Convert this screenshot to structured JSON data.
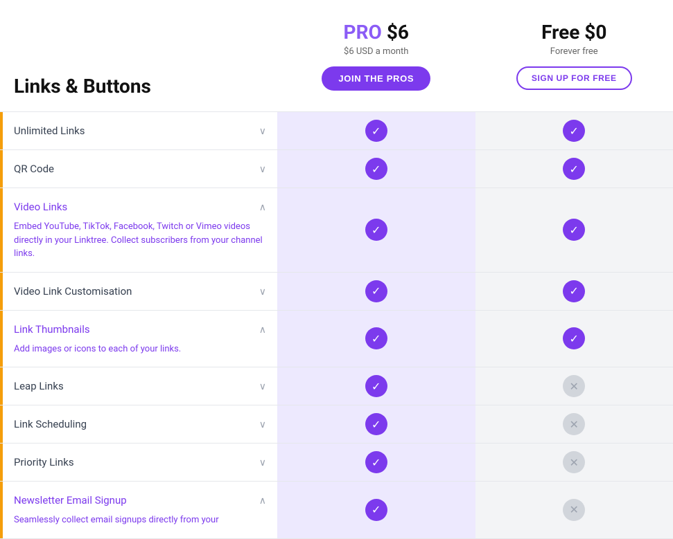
{
  "page": {
    "section_title": "Links & Buttons"
  },
  "plans": {
    "pro": {
      "name": "PRO",
      "price": "$6",
      "subtitle": "$6 USD a month",
      "cta_label": "JOIN THE PROS",
      "color": "#7c3aed"
    },
    "free": {
      "name": "Free",
      "price": "$0",
      "subtitle": "Forever free",
      "cta_label": "SIGN UP FOR FREE"
    }
  },
  "features": [
    {
      "id": "unlimited-links",
      "name": "Unlimited Links",
      "expanded": false,
      "highlight": false,
      "description": null,
      "pro": true,
      "free": true
    },
    {
      "id": "qr-code",
      "name": "QR Code",
      "expanded": false,
      "highlight": false,
      "description": null,
      "pro": true,
      "free": true
    },
    {
      "id": "video-links",
      "name": "Video Links",
      "expanded": true,
      "highlight": true,
      "description": "Embed YouTube, TikTok, Facebook, Twitch or Vimeo videos directly in your Linktree. Collect subscribers from your channel links.",
      "pro": true,
      "free": true
    },
    {
      "id": "video-link-customisation",
      "name": "Video Link Customisation",
      "expanded": false,
      "highlight": false,
      "description": null,
      "pro": true,
      "free": true
    },
    {
      "id": "link-thumbnails",
      "name": "Link Thumbnails",
      "expanded": true,
      "highlight": true,
      "description": "Add images or icons to each of your links.",
      "pro": true,
      "free": true
    },
    {
      "id": "leap-links",
      "name": "Leap Links",
      "expanded": false,
      "highlight": false,
      "description": null,
      "pro": true,
      "free": false
    },
    {
      "id": "link-scheduling",
      "name": "Link Scheduling",
      "expanded": false,
      "highlight": false,
      "description": null,
      "pro": true,
      "free": false
    },
    {
      "id": "priority-links",
      "name": "Priority Links",
      "expanded": false,
      "highlight": false,
      "description": null,
      "pro": true,
      "free": false
    },
    {
      "id": "newsletter-email-signup",
      "name": "Newsletter Email Signup",
      "expanded": true,
      "highlight": true,
      "description": "Seamlessly collect email signups directly from your",
      "pro": true,
      "free": false
    }
  ],
  "icons": {
    "chevron_down": "∨",
    "chevron_up": "∧",
    "check": "✓",
    "x": "✕"
  }
}
